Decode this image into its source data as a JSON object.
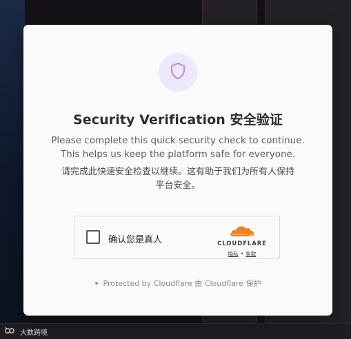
{
  "modal": {
    "title": "Security Verification  安全验证",
    "description_en_line1": "Please complete this quick security check to continue.",
    "description_en_line2": "This helps us keep the platform safe for everyone.",
    "description_cn_line1": "请完成此快速安全检查以继续。这有助于我们为所有人保持",
    "description_cn_line2": "平台安全。",
    "footer": "Protected by Cloudflare  由 Cloudflare 保护"
  },
  "widget": {
    "checkbox_label": "确认您是真人",
    "brand": "CLOUDFLARE",
    "privacy_link": "隐私",
    "separator": "•",
    "terms_link": "条款"
  },
  "background": {
    "bottom_text": "大数跨境"
  },
  "colors": {
    "accent": "#b98ae6",
    "cloudflare_orange": "#f38020",
    "status_green": "#4ac36a"
  }
}
